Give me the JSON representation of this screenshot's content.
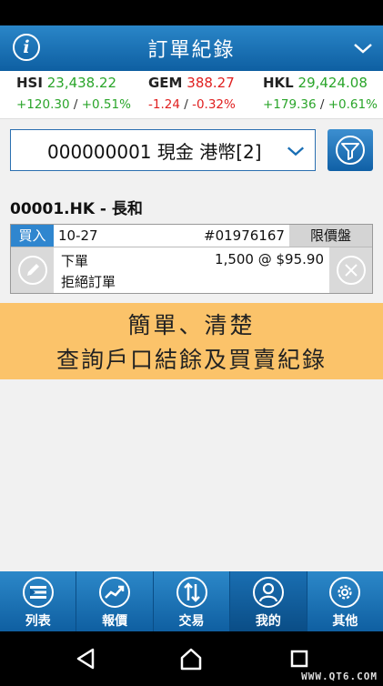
{
  "app": {
    "title": "訂單紀錄"
  },
  "ticker": [
    {
      "code": "HSI",
      "value": "23,438.22",
      "change": "+120.30",
      "percent": "+0.51%",
      "direction": "up"
    },
    {
      "code": "GEM",
      "value": "388.27",
      "change": "-1.24",
      "percent": "-0.32%",
      "direction": "down"
    },
    {
      "code": "HKL",
      "value": "29,424.08",
      "change": "+179.36",
      "percent": "+0.61%",
      "direction": "up"
    }
  ],
  "account": {
    "selected": "000000001 現金 港幣[2]"
  },
  "stock": {
    "title": "00001.HK - 長和"
  },
  "order": {
    "side": "買入",
    "date": "10-27",
    "order_no": "#01976167",
    "order_type": "限價盤",
    "action": "下單",
    "quantity_price": "1,500 @ $95.90",
    "status": "拒絕訂單"
  },
  "promo": {
    "line1": "簡單、清楚",
    "line2": "查詢戶口結餘及買賣紀錄"
  },
  "nav": [
    {
      "label": "列表",
      "icon": "list-icon"
    },
    {
      "label": "報價",
      "icon": "trend-chart-icon"
    },
    {
      "label": "交易",
      "icon": "trade-arrows-icon"
    },
    {
      "label": "我的",
      "icon": "user-icon",
      "active": true
    },
    {
      "label": "其他",
      "icon": "gear-icon"
    }
  ],
  "watermark": "WWW.QT6.COM",
  "colors": {
    "primary": "#1a6fb5",
    "up": "#2aa52a",
    "down": "#e02020",
    "promo": "#fbc36a"
  }
}
